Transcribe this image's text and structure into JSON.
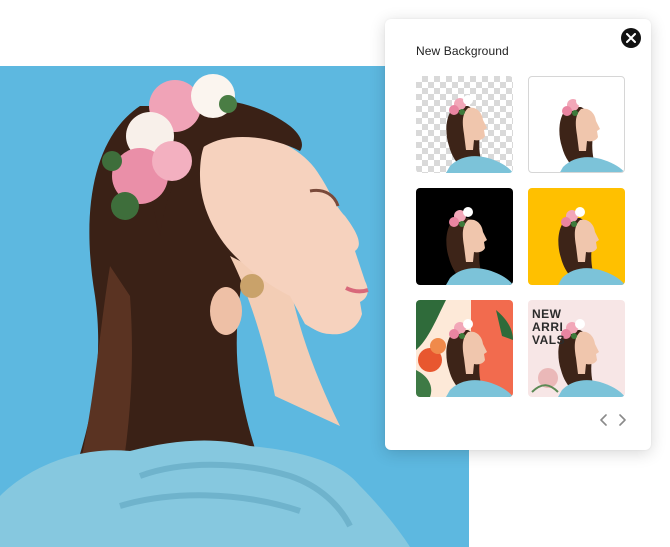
{
  "panel": {
    "title": "New Background",
    "close_icon": "close-icon",
    "thumbnails": [
      {
        "background": "transparent-checkerboard"
      },
      {
        "background": "white",
        "color": "#ffffff"
      },
      {
        "background": "black",
        "color": "#000000"
      },
      {
        "background": "yellow",
        "color": "#ffc000"
      },
      {
        "background": "floral",
        "color": "#f26b4e"
      },
      {
        "background": "new-arrivals",
        "color": "#f7e6e6",
        "text": "NEW\nARRI\nVALS"
      }
    ],
    "nav": {
      "prev_icon": "chevron-left-icon",
      "next_icon": "chevron-right-icon"
    }
  },
  "photo": {
    "background_color": "#5db8e0"
  }
}
